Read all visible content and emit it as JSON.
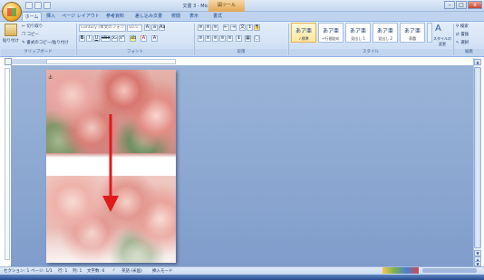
{
  "window": {
    "title": "文書 3 - Microsoft Word",
    "context_tab": "図ツール",
    "minimize": "–",
    "maximize": "□",
    "close": "x"
  },
  "tabs": [
    "ホーム",
    "挿入",
    "ページ レイアウト",
    "参考資料",
    "差し込み文書",
    "校閲",
    "表示",
    "書式"
  ],
  "ribbon": {
    "clipboard": {
      "paste": "貼り付け",
      "cut": "切り取り",
      "copy": "コピー",
      "format_painter": "書式のコピー/貼り付け",
      "label": "クリップボード"
    },
    "font": {
      "font_name": "Century (本文のフォント -",
      "font_size": "10.5",
      "label": "フォント",
      "bold": "B",
      "italic": "I",
      "underline": "U",
      "strike": "abe",
      "subscript": "x₂",
      "superscript": "x²",
      "clear": "Aa",
      "highlight": "ab",
      "color": "A"
    },
    "paragraph": {
      "label": "段落"
    },
    "styles": {
      "items": [
        {
          "sample": "あア亜",
          "label": "✓標準"
        },
        {
          "sample": "あア亜",
          "label": "↵行間詰め"
        },
        {
          "sample": "あア亜",
          "label": "見出し 1"
        },
        {
          "sample": "あア亜",
          "label": "見出し 2"
        },
        {
          "sample": "あア亜",
          "label": "表題"
        }
      ],
      "change_styles": "スタイルの変更",
      "label": "スタイル"
    },
    "editing": {
      "find": "検索",
      "replace": "置換",
      "select": "選択",
      "label": "編集"
    }
  },
  "status": {
    "section": "セクション: 1",
    "page": "ページ: 1/1",
    "line": "行: 1",
    "column": "列: 1",
    "words": "文字数: 0",
    "language": "英語 (米国)",
    "mode": "挿入モード"
  },
  "colors": {
    "arrow": "#e0191b",
    "doc_background": "#8fa9d2"
  }
}
